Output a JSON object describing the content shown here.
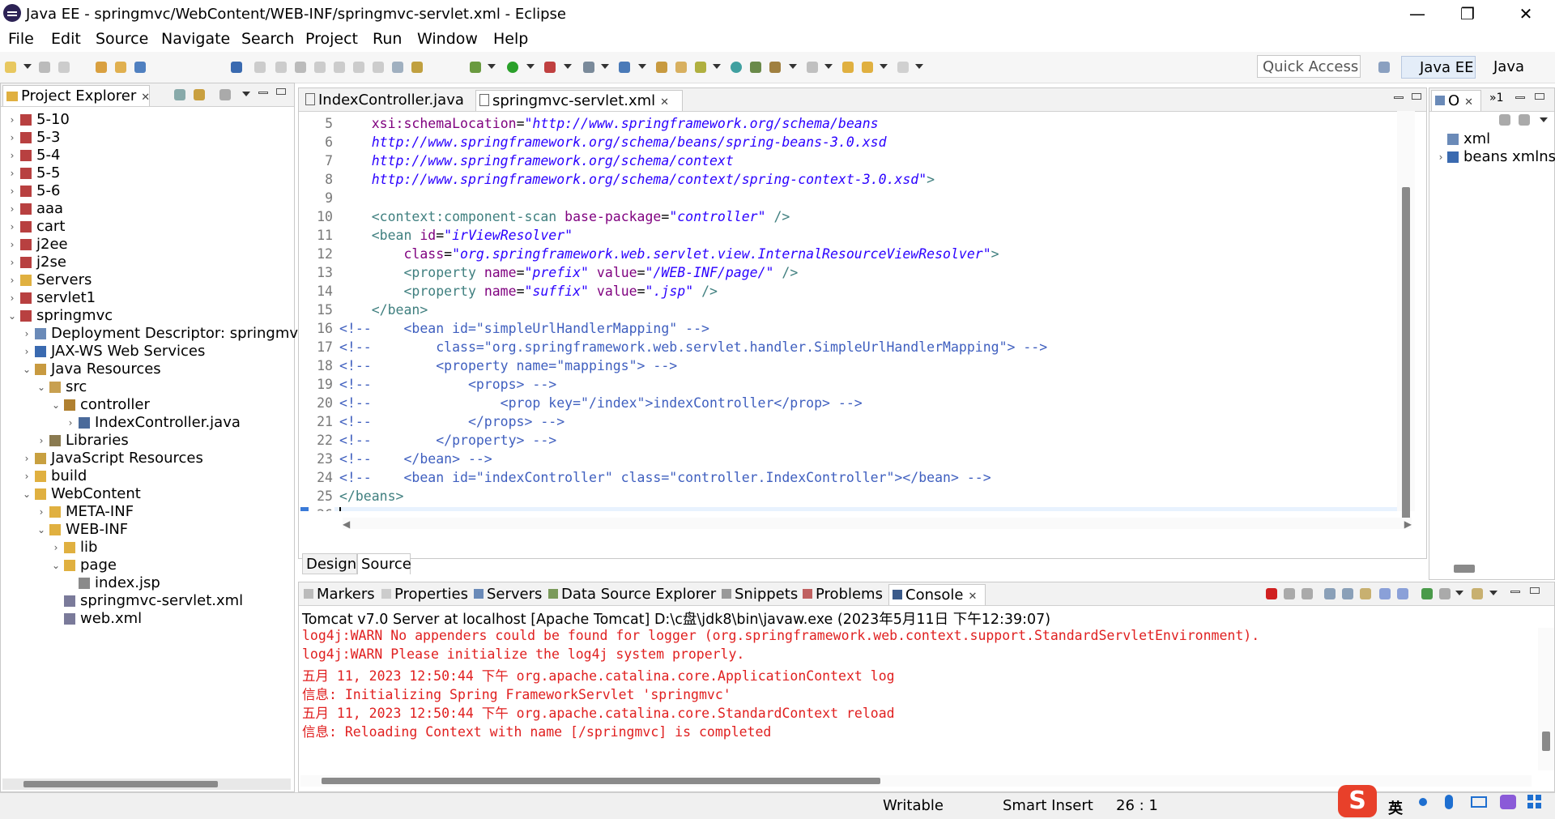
{
  "window": {
    "title": "Java EE - springmvc/WebContent/WEB-INF/springmvc-servlet.xml - Eclipse",
    "minimize": "—",
    "maximize": "❐",
    "close": "✕"
  },
  "menu": [
    "File",
    "Edit",
    "Source",
    "Navigate",
    "Search",
    "Project",
    "Run",
    "Window",
    "Help"
  ],
  "toolbar": {
    "quick_access": "Quick Access",
    "perspectives": [
      "Java EE",
      "Java"
    ]
  },
  "project_explorer": {
    "title": "Project Explorer",
    "items": [
      {
        "label": "5-10",
        "depth": 0,
        "expand": "›",
        "icon": "project-icon"
      },
      {
        "label": "5-3",
        "depth": 0,
        "expand": "›",
        "icon": "project-icon"
      },
      {
        "label": "5-4",
        "depth": 0,
        "expand": "›",
        "icon": "project-icon"
      },
      {
        "label": "5-5",
        "depth": 0,
        "expand": "›",
        "icon": "project-icon"
      },
      {
        "label": "5-6",
        "depth": 0,
        "expand": "›",
        "icon": "project-icon"
      },
      {
        "label": "aaa",
        "depth": 0,
        "expand": "›",
        "icon": "project-icon"
      },
      {
        "label": "cart",
        "depth": 0,
        "expand": "›",
        "icon": "project-icon"
      },
      {
        "label": "j2ee",
        "depth": 0,
        "expand": "›",
        "icon": "project-icon"
      },
      {
        "label": "j2se",
        "depth": 0,
        "expand": "›",
        "icon": "project-icon"
      },
      {
        "label": "Servers",
        "depth": 0,
        "expand": "›",
        "icon": "folder-icon"
      },
      {
        "label": "servlet1",
        "depth": 0,
        "expand": "›",
        "icon": "project-icon"
      },
      {
        "label": "springmvc",
        "depth": 0,
        "expand": "⌄",
        "icon": "project-icon"
      },
      {
        "label": "Deployment Descriptor: springmvc",
        "depth": 1,
        "expand": "›",
        "icon": "descriptor-icon"
      },
      {
        "label": "JAX-WS Web Services",
        "depth": 1,
        "expand": "›",
        "icon": "webservice-icon"
      },
      {
        "label": "Java Resources",
        "depth": 1,
        "expand": "⌄",
        "icon": "java-resources-icon"
      },
      {
        "label": "src",
        "depth": 2,
        "expand": "⌄",
        "icon": "source-folder-icon"
      },
      {
        "label": "controller",
        "depth": 3,
        "expand": "⌄",
        "icon": "package-icon"
      },
      {
        "label": "IndexController.java",
        "depth": 4,
        "expand": "›",
        "icon": "java-file-icon"
      },
      {
        "label": "Libraries",
        "depth": 2,
        "expand": "›",
        "icon": "library-icon"
      },
      {
        "label": "JavaScript Resources",
        "depth": 1,
        "expand": "›",
        "icon": "js-resources-icon"
      },
      {
        "label": "build",
        "depth": 1,
        "expand": "›",
        "icon": "folder-icon"
      },
      {
        "label": "WebContent",
        "depth": 1,
        "expand": "⌄",
        "icon": "folder-icon"
      },
      {
        "label": "META-INF",
        "depth": 2,
        "expand": "›",
        "icon": "folder-icon"
      },
      {
        "label": "WEB-INF",
        "depth": 2,
        "expand": "⌄",
        "icon": "folder-icon"
      },
      {
        "label": "lib",
        "depth": 3,
        "expand": "›",
        "icon": "folder-icon"
      },
      {
        "label": "page",
        "depth": 3,
        "expand": "⌄",
        "icon": "folder-icon"
      },
      {
        "label": "index.jsp",
        "depth": 4,
        "expand": "",
        "icon": "jsp-file-icon"
      },
      {
        "label": "springmvc-servlet.xml",
        "depth": 3,
        "expand": "",
        "icon": "xml-file-icon"
      },
      {
        "label": "web.xml",
        "depth": 3,
        "expand": "",
        "icon": "xml-file-icon"
      }
    ]
  },
  "editor": {
    "tabs": [
      {
        "label": "IndexController.java",
        "active": false
      },
      {
        "label": "springmvc-servlet.xml",
        "active": true
      }
    ],
    "bottom_tabs": [
      "Design",
      "Source"
    ],
    "lines": [
      {
        "n": "5",
        "segs": [
          [
            "plain",
            "    "
          ],
          [
            "att",
            "xsi:schemaLocation"
          ],
          [
            "plain",
            "="
          ],
          [
            "val",
            "\"http://www.springframework.org/schema/beans"
          ]
        ]
      },
      {
        "n": "6",
        "segs": [
          [
            "val",
            "    http://www.springframework.org/schema/beans/spring-beans-3.0.xsd"
          ]
        ]
      },
      {
        "n": "7",
        "segs": [
          [
            "val",
            "    http://www.springframework.org/schema/context"
          ]
        ]
      },
      {
        "n": "8",
        "segs": [
          [
            "val",
            "    http://www.springframework.org/schema/context/spring-context-3.0.xsd\""
          ],
          [
            "tag",
            ">"
          ]
        ]
      },
      {
        "n": "9",
        "segs": []
      },
      {
        "n": "10",
        "segs": [
          [
            "tag",
            "    <context:component-scan "
          ],
          [
            "att",
            "base-package"
          ],
          [
            "plain",
            "="
          ],
          [
            "val",
            "\"controller\""
          ],
          [
            "tag",
            " />"
          ]
        ]
      },
      {
        "n": "11",
        "segs": [
          [
            "tag",
            "    <bean "
          ],
          [
            "att",
            "id"
          ],
          [
            "plain",
            "="
          ],
          [
            "val",
            "\"irViewResolver\""
          ]
        ]
      },
      {
        "n": "12",
        "segs": [
          [
            "att",
            "        class"
          ],
          [
            "plain",
            "="
          ],
          [
            "val",
            "\"org.springframework.web.servlet.view.InternalResourceViewResolver\""
          ],
          [
            "tag",
            ">"
          ]
        ]
      },
      {
        "n": "13",
        "segs": [
          [
            "tag",
            "        <property "
          ],
          [
            "att",
            "name"
          ],
          [
            "plain",
            "="
          ],
          [
            "val",
            "\"prefix\""
          ],
          [
            "att",
            " value"
          ],
          [
            "plain",
            "="
          ],
          [
            "val",
            "\"/WEB-INF/page/\""
          ],
          [
            "tag",
            " />"
          ]
        ]
      },
      {
        "n": "14",
        "segs": [
          [
            "tag",
            "        <property "
          ],
          [
            "att",
            "name"
          ],
          [
            "plain",
            "="
          ],
          [
            "val",
            "\"suffix\""
          ],
          [
            "att",
            " value"
          ],
          [
            "plain",
            "="
          ],
          [
            "val",
            "\".jsp\""
          ],
          [
            "tag",
            " />"
          ]
        ]
      },
      {
        "n": "15",
        "segs": [
          [
            "tag",
            "    </bean>"
          ]
        ]
      },
      {
        "n": "16",
        "segs": [
          [
            "com",
            "<!--    <bean id=\"simpleUrlHandlerMapping\" -->"
          ]
        ]
      },
      {
        "n": "17",
        "segs": [
          [
            "com",
            "<!--        class=\"org.springframework.web.servlet.handler.SimpleUrlHandlerMapping\"> -->"
          ]
        ]
      },
      {
        "n": "18",
        "segs": [
          [
            "com",
            "<!--        <property name=\"mappings\"> -->"
          ]
        ]
      },
      {
        "n": "19",
        "segs": [
          [
            "com",
            "<!--            <props> -->"
          ]
        ]
      },
      {
        "n": "20",
        "segs": [
          [
            "com",
            "<!--                <prop key=\"/index\">indexController</prop> -->"
          ]
        ]
      },
      {
        "n": "21",
        "segs": [
          [
            "com",
            "<!--            </props> -->"
          ]
        ]
      },
      {
        "n": "22",
        "segs": [
          [
            "com",
            "<!--        </property> -->"
          ]
        ]
      },
      {
        "n": "23",
        "segs": [
          [
            "com",
            "<!--    </bean> -->"
          ]
        ]
      },
      {
        "n": "24",
        "segs": [
          [
            "com",
            "<!--    <bean id=\"indexController\" class=\"controller.IndexController\"></bean> -->"
          ]
        ]
      },
      {
        "n": "25",
        "segs": [
          [
            "tag",
            "</beans>"
          ]
        ]
      },
      {
        "n": "26",
        "segs": []
      }
    ]
  },
  "outline": {
    "tab_label": "O",
    "items": [
      {
        "label": "xml",
        "icon": "pi-icon"
      },
      {
        "label": "beans xmlns",
        "icon": "element-icon"
      }
    ]
  },
  "bottom_panel": {
    "tabs": [
      "Markers",
      "Properties",
      "Servers",
      "Data Source Explorer",
      "Snippets",
      "Problems",
      "Console"
    ],
    "active_tab": "Console",
    "console_header": "Tomcat v7.0 Server at localhost [Apache Tomcat] D:\\c盘\\jdk8\\bin\\javaw.exe (2023年5月11日 下午12:39:07)",
    "console_lines": [
      "log4j:WARN No appenders could be found for logger (org.springframework.web.context.support.StandardServletEnvironment).",
      "log4j:WARN Please initialize the log4j system properly.",
      "五月 11, 2023 12:50:44 下午 org.apache.catalina.core.ApplicationContext log",
      "信息: Initializing Spring FrameworkServlet 'springmvc'",
      "五月 11, 2023 12:50:44 下午 org.apache.catalina.core.StandardContext reload",
      "信息: Reloading Context with name [/springmvc] is completed"
    ]
  },
  "status": {
    "writable": "Writable",
    "insert_mode": "Smart Insert",
    "position": "26 : 1"
  },
  "tray": {
    "ime_label": "英"
  }
}
